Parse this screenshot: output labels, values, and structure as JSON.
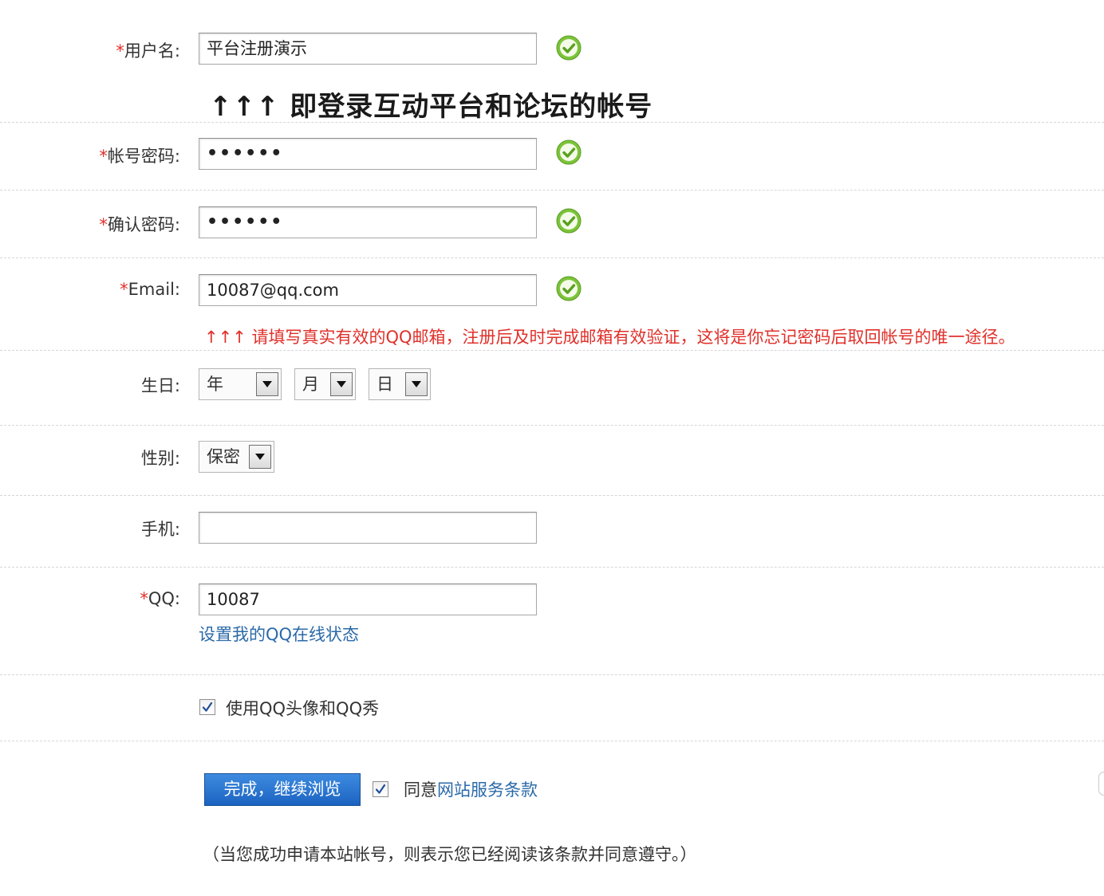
{
  "form": {
    "username": {
      "required_mark": "*",
      "label": "用户名:",
      "value": "平台注册演示",
      "status_icon": "check-circle-icon"
    },
    "username_hint": "↑↑↑ 即登录互动平台和论坛的帐号",
    "password": {
      "required_mark": "*",
      "label": "帐号密码:",
      "value": "••••••",
      "status_icon": "check-circle-icon"
    },
    "confirm_password": {
      "required_mark": "*",
      "label": "确认密码:",
      "value": "••••••",
      "status_icon": "check-circle-icon"
    },
    "email": {
      "required_mark": "*",
      "label": "Email:",
      "value": "10087@qq.com",
      "status_icon": "check-circle-icon"
    },
    "email_hint": "↑↑↑ 请填写真实有效的QQ邮箱，注册后及时完成邮箱有效验证，这将是你忘记密码后取回帐号的唯一途径。",
    "birthday": {
      "label": "生日:",
      "year": "年",
      "month": "月",
      "day": "日"
    },
    "gender": {
      "label": "性别:",
      "value": "保密"
    },
    "mobile": {
      "label": "手机:",
      "value": ""
    },
    "qq": {
      "required_mark": "*",
      "label": "QQ:",
      "value": "10087",
      "status_link": "设置我的QQ在线状态"
    },
    "use_qq_avatar": {
      "checked": true,
      "label": "使用QQ头像和QQ秀"
    },
    "submit_label": "完成，继续浏览",
    "agree": {
      "checked": true,
      "prefix": "同意",
      "link": "网站服务条款"
    },
    "notice": "（当您成功申请本站帐号，则表示您已经阅读该条款并同意遵守。）"
  },
  "colors": {
    "required": "#e0302a",
    "hint_red": "#e0302a",
    "link": "#2b6aa8",
    "ok_icon": "#7cc43a",
    "button": "#1c63c1"
  }
}
